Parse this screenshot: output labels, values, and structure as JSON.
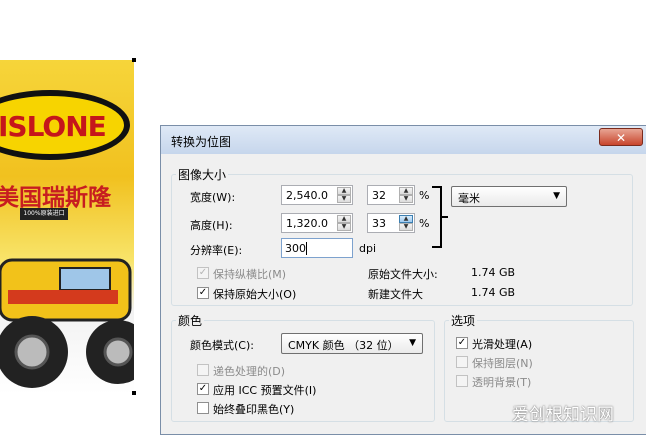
{
  "dialog": {
    "title": "转换为位图",
    "close_symbol": "✕",
    "image_size": {
      "legend": "图像大小",
      "width_label": "宽度(W):",
      "width_value": "2,540.0",
      "width_percent": "32",
      "height_label": "高度(H):",
      "height_value": "1,320.0",
      "height_percent": "33",
      "percent_symbol": "%",
      "unit": "毫米",
      "resolution_label": "分辨率(E):",
      "resolution_value": "300",
      "resolution_unit": "dpi",
      "keep_ratio_label": "保持纵横比(M)",
      "keep_ratio_checked": true,
      "keep_ratio_enabled": false,
      "keep_original_label": "保持原始大小(O)",
      "keep_original_checked": true,
      "original_file_size_label": "原始文件大小:",
      "original_file_size_value": "1.74 GB",
      "new_file_size_label": "新建文件大",
      "new_file_size_value": "1.74 GB"
    },
    "color": {
      "legend": "颜色",
      "mode_label": "颜色模式(C):",
      "mode_value": "CMYK 颜色 （32 位）",
      "dither_label": "递色处理的(D)",
      "dither_checked": false,
      "dither_enabled": false,
      "icc_label": "应用 ICC 预置文件(I)",
      "icc_checked": true,
      "overprint_label": "始终叠印黑色(Y)",
      "overprint_checked": false
    },
    "options": {
      "legend": "选项",
      "smooth_label": "光滑处理(A)",
      "smooth_checked": true,
      "keep_layers_label": "保持图层(N)",
      "keep_layers_checked": false,
      "keep_layers_enabled": false,
      "transparent_bg_label": "透明背景(T)",
      "transparent_bg_checked": false,
      "transparent_bg_enabled": false
    }
  },
  "background_image": {
    "logo_text": "ISLONE",
    "brand_text": "美国瑞斯隆",
    "badge_text": "100%原装进口"
  },
  "watermark": "爱创根知识网",
  "icons": {
    "check": "✓",
    "spin_up": "▲",
    "spin_down": "▼",
    "dropdown": "▼"
  }
}
